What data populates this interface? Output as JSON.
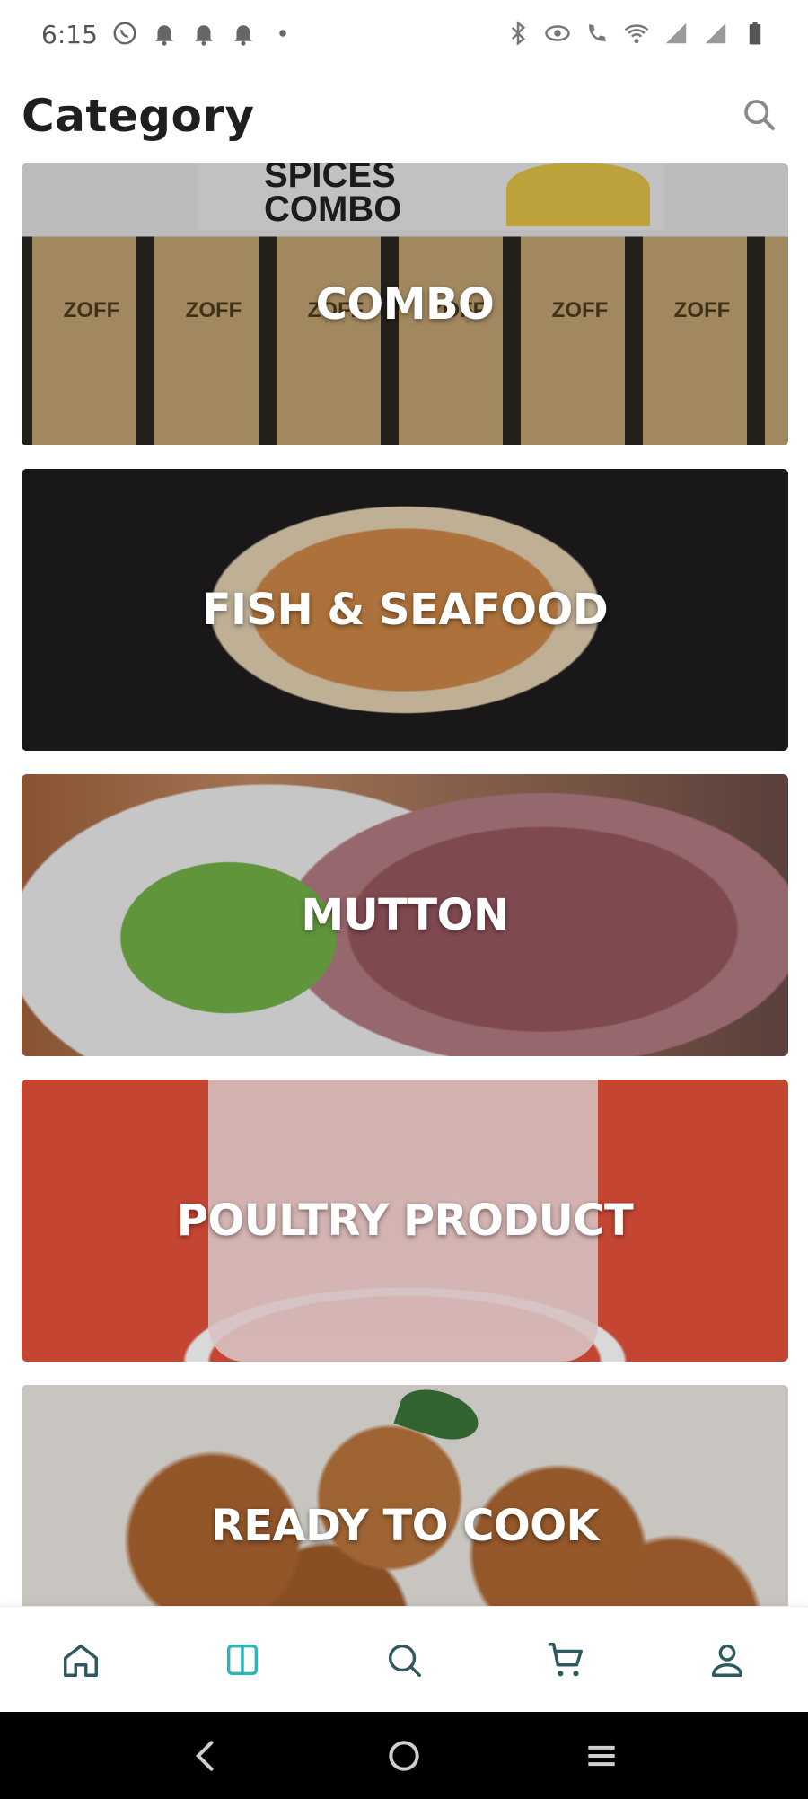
{
  "status_bar": {
    "time": "6:15"
  },
  "header": {
    "title": "Category"
  },
  "categories": [
    {
      "label": "COMBO",
      "banner_text": "SPICES\nCOMBO",
      "brand": "ZOFF"
    },
    {
      "label": "FISH & SEAFOOD"
    },
    {
      "label": "MUTTON"
    },
    {
      "label": "POULTRY PRODUCT"
    },
    {
      "label": "READY TO COOK"
    }
  ],
  "bottom_nav": {
    "items": [
      {
        "icon": "home-icon",
        "active": false
      },
      {
        "icon": "category-icon",
        "active": true
      },
      {
        "icon": "search-icon",
        "active": false
      },
      {
        "icon": "cart-icon",
        "active": false
      },
      {
        "icon": "profile-icon",
        "active": false
      }
    ],
    "active_color": "#2bb5b8",
    "inactive_color": "#2f5960"
  },
  "system_nav": {
    "buttons": [
      "back-icon",
      "home-circle-icon",
      "recents-icon"
    ]
  }
}
